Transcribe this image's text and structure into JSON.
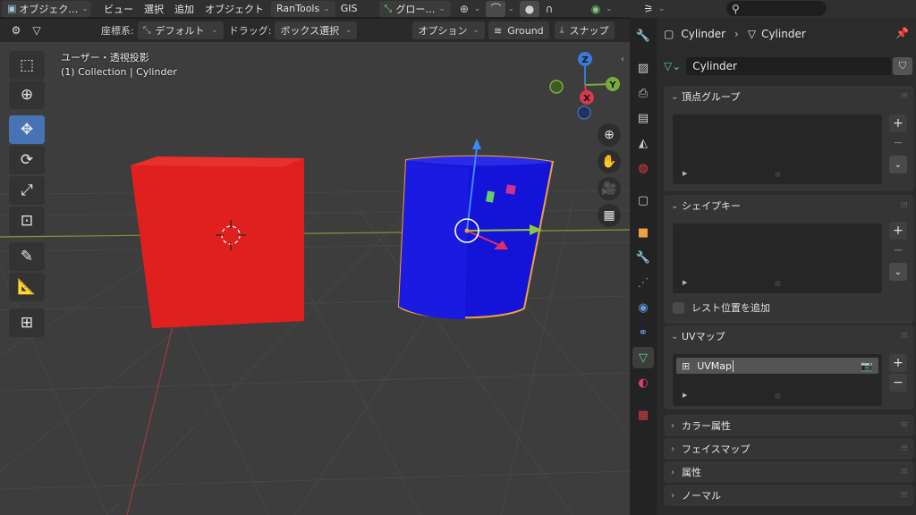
{
  "header": {
    "mode_label": "オブジェク…",
    "menus": [
      "ビュー",
      "選択",
      "追加",
      "オブジェクト"
    ],
    "addon_label": "RanTools",
    "gis_label": "GIS",
    "transform_label": "グロー…"
  },
  "subheader": {
    "orientation_label": "座標系:",
    "orientation_value": "デフォルト",
    "drag_label": "ドラッグ:",
    "drag_value": "ボックス選択",
    "options_label": "オプション",
    "ground_label": "Ground",
    "snap_label": "スナップ"
  },
  "viewport": {
    "view_name": "ユーザー・透視投影",
    "collection_info": "(1) Collection | Cylinder",
    "axes": {
      "z": "Z",
      "y": "Y",
      "x": "X"
    },
    "cube_color": "#e0201e",
    "cylinder_color": "#1414d8",
    "selection_outline": "#f0a040"
  },
  "properties": {
    "breadcrumb": {
      "object": "Cylinder",
      "mesh": "Cylinder"
    },
    "data_name": "Cylinder",
    "fake_user_icon": "shield-icon",
    "panels": {
      "vertex_groups": "頂点グループ",
      "shape_keys": "シェイプキー",
      "add_rest_position": "レスト位置を追加",
      "uv_maps": "UVマップ",
      "uv_map_name": "UVMap",
      "color_attributes": "カラー属性",
      "face_maps": "フェイスマップ",
      "attributes": "属性",
      "normals": "ノーマル"
    }
  }
}
